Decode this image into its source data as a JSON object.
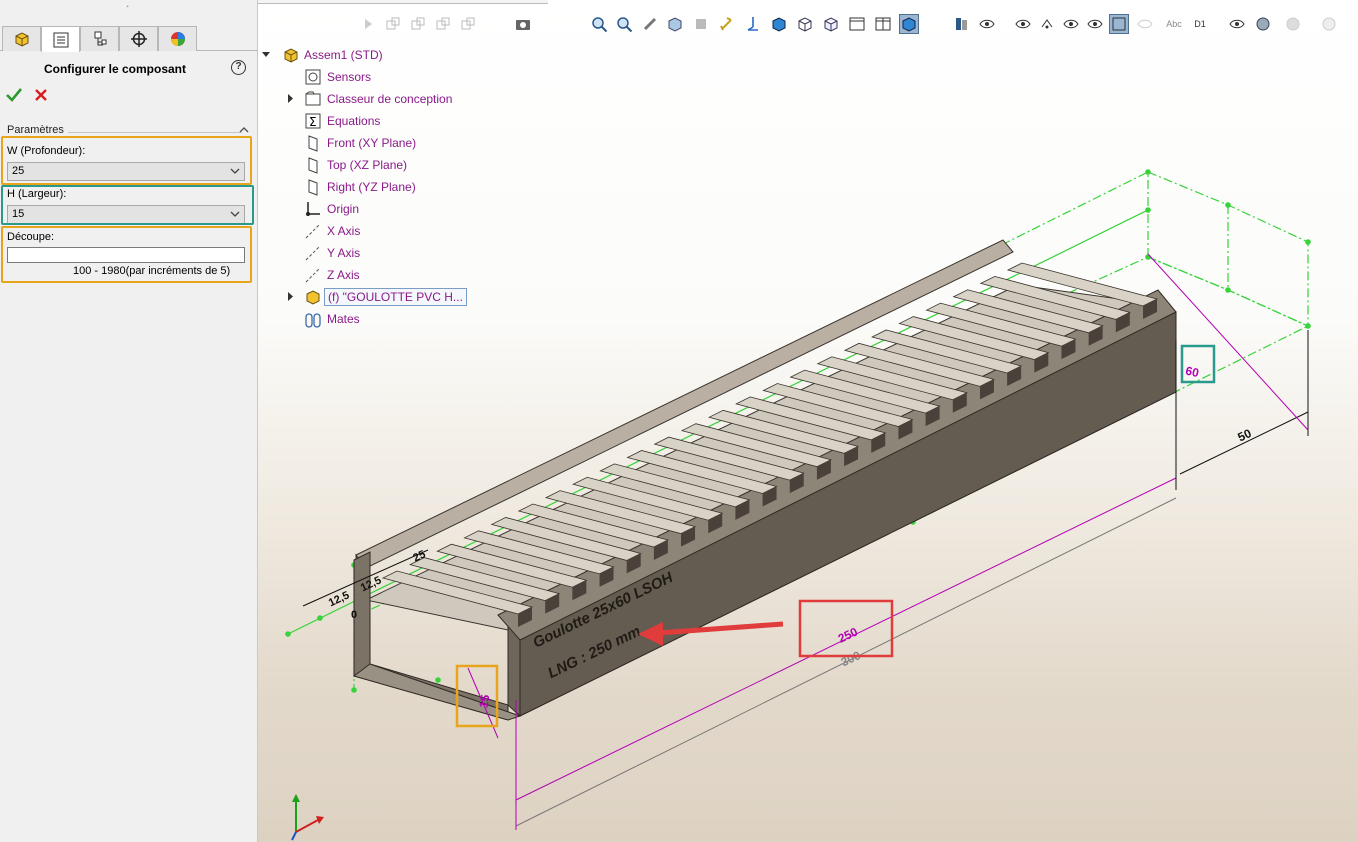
{
  "property_manager": {
    "tabs": [
      {
        "name": "feature-manager",
        "icon": "assembly-icon"
      },
      {
        "name": "property-manager",
        "icon": "property-list-icon"
      },
      {
        "name": "configuration-manager",
        "icon": "configuration-icon"
      },
      {
        "name": "dimxpert-manager",
        "icon": "crosshair-icon"
      },
      {
        "name": "display-manager",
        "icon": "appearance-sphere-icon"
      }
    ],
    "title": "Configurer le composant",
    "help": "?",
    "ok_icon": "checkmark-icon",
    "cancel_icon": "close-icon",
    "group_label": "Paramètres",
    "fields": {
      "w_label": "W (Profondeur):",
      "w_value": "25",
      "h_label": "H (Largeur):",
      "h_value": "15",
      "decoupe_label": "Découpe:",
      "decoupe_value": "",
      "decoupe_hint": "100 - 1980(par incréments de 5)"
    },
    "highlight_colors": {
      "w": "#e8a51c",
      "h": "#2a9a8c",
      "decoupe": "#e8a51c"
    }
  },
  "feature_tree": {
    "items": [
      {
        "label": "Assem1  (STD)",
        "icon": "assembly-icon",
        "expandable": true,
        "expanded": true
      },
      {
        "label": "Sensors",
        "icon": "sensor-icon"
      },
      {
        "label": "Classeur de conception",
        "icon": "folder-icon",
        "expandable": true
      },
      {
        "label": "Equations",
        "icon": "equation-icon"
      },
      {
        "label": "Front (XY Plane)",
        "icon": "plane-icon"
      },
      {
        "label": "Top (XZ Plane)",
        "icon": "plane-icon"
      },
      {
        "label": "Right (YZ Plane)",
        "icon": "plane-icon"
      },
      {
        "label": "Origin",
        "icon": "origin-icon"
      },
      {
        "label": "X Axis",
        "icon": "axis-icon"
      },
      {
        "label": "Y Axis",
        "icon": "axis-icon"
      },
      {
        "label": "Z Axis",
        "icon": "axis-icon"
      },
      {
        "label": "(f) \"GOULOTTE PVC H...",
        "icon": "part-icon",
        "expandable": true,
        "selected": true
      },
      {
        "label": "Mates",
        "icon": "mates-icon"
      }
    ]
  },
  "toolbar": {
    "icons": [
      "play-icon",
      "sketch-icon",
      "sketch-icon",
      "sketch-icon",
      "sketch-icon",
      "camera-icon",
      "zoom-fit-icon",
      "zoom-area-icon",
      "previous-view-icon",
      "section-view-icon",
      "dynamic-annotation-icon",
      "view-orientation-icon",
      "isometric-cube-icon",
      "cube-wireframe-icon",
      "single-view-icon",
      "two-view-icon",
      "shaded-cube-icon",
      "hide-show-icon",
      "eye-icon",
      "eye-icon",
      "eye-icon",
      "eye-icon",
      "eye-icon",
      "edit-appearance-icon",
      "eye-icon",
      "eye-icon",
      "eye-icon",
      "scene-icon",
      "monitor-icon",
      "more-icon"
    ],
    "label_abc": "Abc",
    "label_d1": "D1"
  },
  "model": {
    "colors": {
      "profile": "#6e655a",
      "profile_dark": "#4a423a",
      "slat": "#d9d2c6",
      "green": "#37d33a",
      "magenta": "#b400b4",
      "red": "#e03c3c"
    },
    "dimensions": {
      "dim_60": "60",
      "dim_50": "50",
      "dim_250_highlight": "250",
      "dim_300": "300",
      "dim_12_5_a": "12,5",
      "dim_12_5_b": "12,5",
      "dim_25": "25",
      "dim_0": "0",
      "dim_15_vertical": "15",
      "dim_250_bottom": "250"
    },
    "embossed_text_1": "Goulotte 25x60 LSOH",
    "embossed_text_2": "LNG : 250 mm"
  }
}
